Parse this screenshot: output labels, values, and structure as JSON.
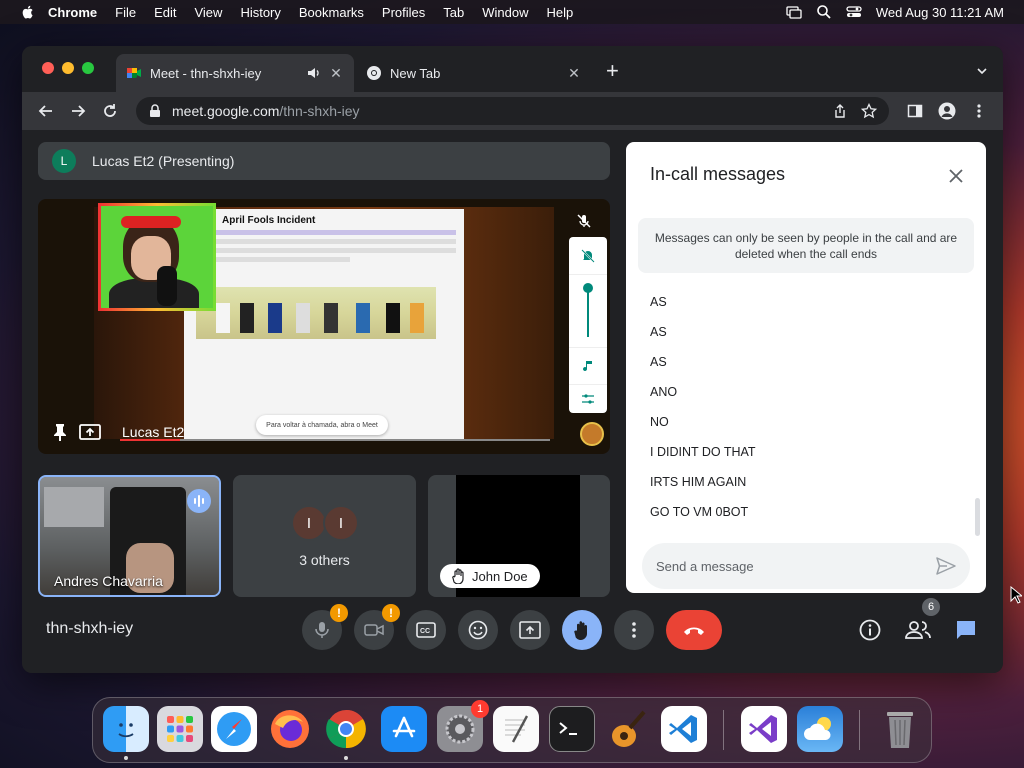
{
  "menubar": {
    "app": "Chrome",
    "items": [
      "File",
      "Edit",
      "View",
      "History",
      "Bookmarks",
      "Profiles",
      "Tab",
      "Window",
      "Help"
    ],
    "datetime": "Wed Aug 30  11:21 AM"
  },
  "browser": {
    "tabs": [
      {
        "title": "Meet - thn-shxh-iey",
        "active": true
      },
      {
        "title": "New Tab",
        "active": false
      }
    ],
    "url_host": "meet.google.com",
    "url_path": "/thn-shxh-iey"
  },
  "meet": {
    "presenter_initial": "L",
    "presenter_label": "Lucas Et2 (Presenting)",
    "stage_name": "Lucas Et2",
    "slide_title": "April Fools Incident",
    "slide_toast": "Para voltar à chamada, abra o Meet",
    "tiles": {
      "andres_name": "Andres Chavarria",
      "others_initials": [
        "I",
        "I"
      ],
      "others_label": "3 others",
      "john_name": "John Doe"
    },
    "meeting_code": "thn-shxh-iey",
    "participant_count": "6",
    "accent": "#8ab4f8",
    "end_call_color": "#ea4335"
  },
  "chat": {
    "title": "In-call messages",
    "notice": "Messages can only be seen by people in the call and are deleted when the call ends",
    "messages": [
      "AS",
      "AS",
      "AS",
      "ANO",
      "NO",
      "I DIDINT DO THAT",
      "IRTS HIM AGAIN",
      "GO TO VM 0BOT"
    ],
    "placeholder": "Send a message"
  },
  "dock": {
    "apps": [
      "finder-icon",
      "launchpad-icon",
      "safari-icon",
      "firefox-icon",
      "chrome-icon",
      "app-store-icon",
      "system-settings-icon",
      "textedit-icon",
      "terminal-icon",
      "garageband-icon",
      "vscode-icon",
      "visual-studio-icon",
      "weather-icon",
      "trash-icon"
    ],
    "settings_badge": "1"
  }
}
